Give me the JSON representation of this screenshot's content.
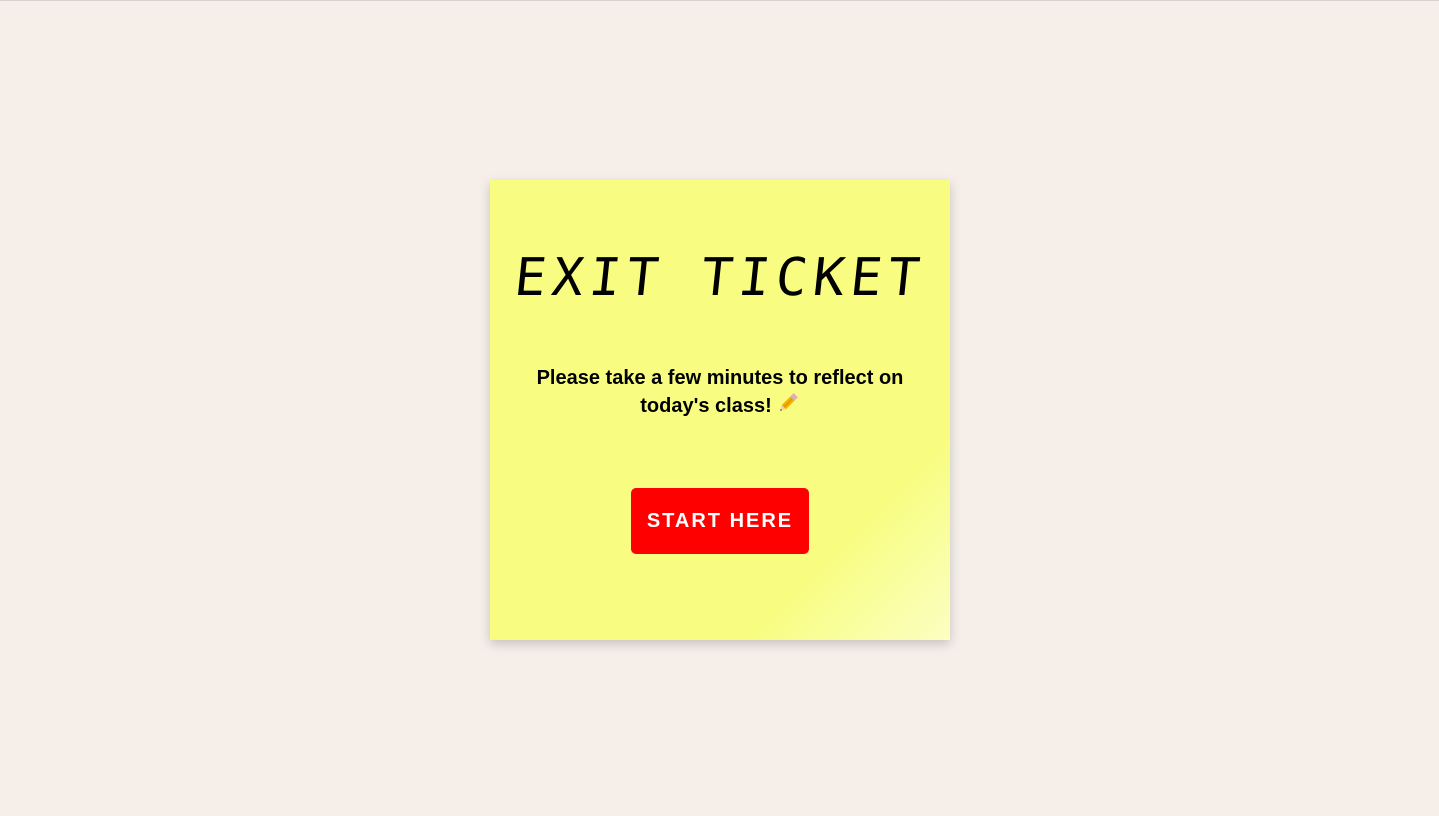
{
  "note": {
    "title": "EXIT TICKET",
    "prompt": "Please take a few minutes to reflect on today's class!",
    "prompt_icon": "pencil-icon",
    "start_button_label": "START HERE"
  },
  "colors": {
    "background": "#f5eee9",
    "note": "#f8fd82",
    "button": "#ff0000",
    "button_text": "#ffffff"
  }
}
